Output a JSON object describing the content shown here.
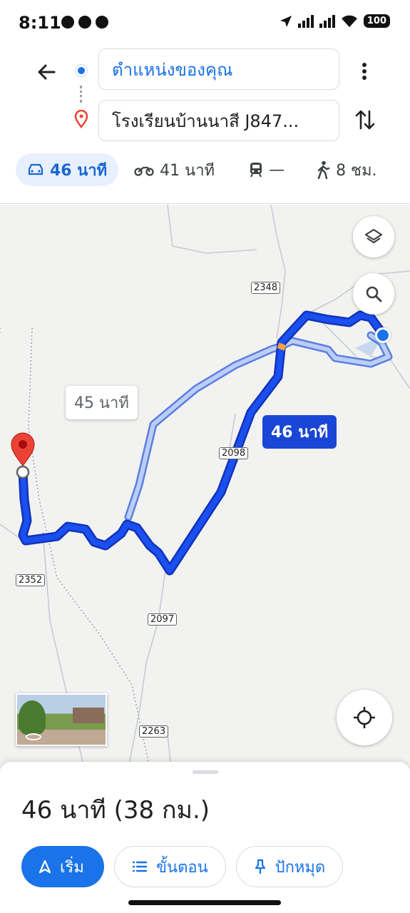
{
  "status_bar": {
    "time": "8:11",
    "battery": "100"
  },
  "route": {
    "origin": "ตำแหน่งของคุณ",
    "destination": "โรงเรียนบ้านนาสี J847..."
  },
  "modes": [
    {
      "name": "car",
      "label": "46 นาที",
      "active": true
    },
    {
      "name": "motorcycle",
      "label": "41 นาที"
    },
    {
      "name": "transit",
      "label": "—"
    },
    {
      "name": "walk",
      "label": "8 ชม."
    }
  ],
  "map": {
    "route_labels": {
      "alternate": "45 นาที",
      "selected": "46 นาที"
    },
    "road_labels": [
      "2348",
      "2098",
      "2352",
      "2097",
      "2263"
    ]
  },
  "sheet": {
    "summary": "46 นาที (38 กม.)",
    "start_label": "เริ่ม",
    "steps_label": "ขั้นตอน",
    "pin_label": "ปักหมุด"
  },
  "colors": {
    "accent": "#1a73e8",
    "route": "#1a46d6",
    "alt_route": "#a8bff5",
    "dest_pin": "#ea4335"
  }
}
